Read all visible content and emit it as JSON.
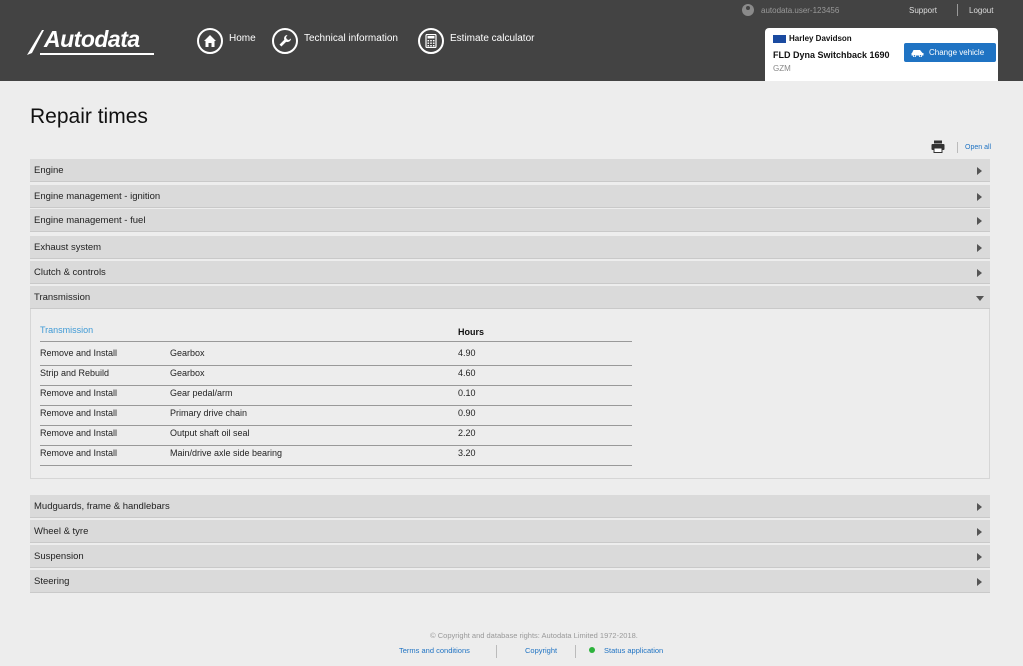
{
  "header": {
    "logo_text": "Autodata",
    "nav": [
      {
        "label": "Home",
        "icon": "home-icon"
      },
      {
        "label": "Technical information",
        "icon": "wrench-icon"
      },
      {
        "label": "Estimate calculator",
        "icon": "calculator-icon"
      }
    ],
    "user": "autodata.user-123456",
    "support": "Support",
    "logout": "Logout"
  },
  "vehicle": {
    "make": "Harley Davidson",
    "model": "FLD Dyna Switchback 1690",
    "code": "GZM",
    "change_label": "Change vehicle"
  },
  "page": {
    "title": "Repair times",
    "open_all": "Open all"
  },
  "sections_top": [
    "Engine",
    "Engine management - ignition",
    "Engine management - fuel",
    "Exhaust system",
    "Clutch & controls",
    "Transmission"
  ],
  "transmission": {
    "subtitle": "Transmission",
    "hours_header": "Hours",
    "rows": [
      {
        "op": "Remove and Install",
        "part": "Gearbox",
        "hours": "4.90"
      },
      {
        "op": "Strip and Rebuild",
        "part": "Gearbox",
        "hours": "4.60"
      },
      {
        "op": "Remove and Install",
        "part": "Gear pedal/arm",
        "hours": "0.10"
      },
      {
        "op": "Remove and Install",
        "part": "Primary drive chain",
        "hours": "0.90"
      },
      {
        "op": "Remove and Install",
        "part": "Output shaft oil seal",
        "hours": "2.20"
      },
      {
        "op": "Remove and Install",
        "part": "Main/drive axle side bearing",
        "hours": "3.20"
      }
    ]
  },
  "sections_bottom": [
    "Mudguards, frame & handlebars",
    "Wheel & tyre",
    "Suspension",
    "Steering"
  ],
  "footer": {
    "copyright": "© Copyright and database rights: Autodata Limited 1972-2018.",
    "terms": "Terms and conditions",
    "copyright_link": "Copyright",
    "status": "Status application"
  },
  "colors": {
    "header_bg": "#434343",
    "accent": "#1f73c3",
    "subtitle": "#3f9ad6",
    "status_ok": "#2db33c"
  }
}
